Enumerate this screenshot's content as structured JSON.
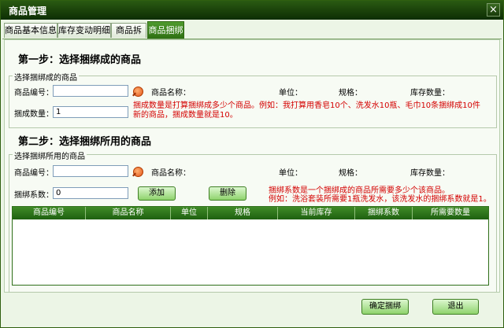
{
  "window": {
    "title": "商品管理",
    "close_label": "×"
  },
  "tabs": [
    {
      "label": "商品基本信息"
    },
    {
      "label": "库存变动明细"
    },
    {
      "label": "商品拆分"
    },
    {
      "label": "商品捆绑"
    }
  ],
  "step1": {
    "heading": "第一步：选择捆绑成的商品",
    "group_title": "选择捆绑成的商品",
    "code_label": "商品编号：",
    "code_value": "",
    "name_label": "商品名称：",
    "unit_label": "单位：",
    "spec_label": "规格：",
    "stock_label": "库存数量：",
    "qty_label": "捆成数量：",
    "qty_value": "1",
    "hint": "捆成数量是打算捆绑成多少个商品。例如：我打算用香皂10个、洗发水10瓶、毛巾10条捆绑成10件新的商品，捆成数量就是10。"
  },
  "step2": {
    "heading": "第二步：选择捆绑所用的商品",
    "group_title": "选择捆绑所用的商品",
    "code_label": "商品编号：",
    "code_value": "",
    "name_label": "商品名称：",
    "unit_label": "单位：",
    "spec_label": "规格：",
    "stock_label": "库存数量：",
    "coef_label": "捆绑系数：",
    "coef_value": "0",
    "add_label": "添加",
    "delete_label": "删除",
    "hint_line1": "捆绑系数是一个捆绑成的商品所需要多少个该商品。",
    "hint_line2": "例如：洗浴套装所需要1瓶洗发水，该洗发水的捆绑系数就是1。",
    "columns": [
      "商品编号",
      "商品名称",
      "单位",
      "规格",
      "当前库存",
      "捆绑系数",
      "所需要数量"
    ]
  },
  "footer": {
    "confirm_label": "确定捆绑",
    "exit_label": "退出"
  }
}
